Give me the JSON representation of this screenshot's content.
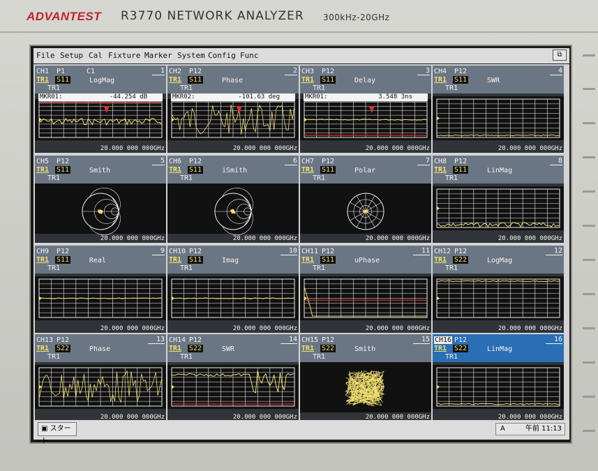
{
  "device": {
    "brand": "ADVANTEST",
    "model": "R3770  NETWORK  ANALYZER",
    "range": "300kHz-20GHz"
  },
  "menu": [
    "File",
    "Setup",
    "Cal",
    "Fixture",
    "Marker",
    "System",
    "Config",
    "Func"
  ],
  "channels": [
    {
      "ch": "CH1",
      "port": "P1",
      "extra": "C1",
      "num": "1",
      "tr": "TR1",
      "s": "S11",
      "fmt": "LogMag",
      "tr2": "TR1",
      "freq": "20.000 000 000GHz",
      "plot": "noise-red",
      "marker": {
        "label": "MKR01:",
        "value": "-44.254 dB"
      }
    },
    {
      "ch": "CH2",
      "port": "P12",
      "extra": "",
      "num": "2",
      "tr": "TR1",
      "s": "S11",
      "fmt": "Phase",
      "tr2": "TR1",
      "freq": "20.000 000 000GHz",
      "plot": "dense",
      "marker": {
        "label": "MKR02:",
        "value": "-101.63 deg"
      }
    },
    {
      "ch": "CH3",
      "port": "P12",
      "extra": "",
      "num": "3",
      "tr": "TR1",
      "s": "S11",
      "fmt": "Delay",
      "tr2": "TR1",
      "freq": "20.000 000 000GHz",
      "plot": "flat-red",
      "marker": {
        "label": "MKR01:",
        "value": "3.548 3ns"
      }
    },
    {
      "ch": "CH4",
      "port": "P12",
      "extra": "",
      "num": "4",
      "tr": "TR1",
      "s": "S11",
      "fmt": "SWR",
      "tr2": "TR1",
      "freq": "20.000 000 000GHz",
      "plot": "grid-bottom",
      "marker": null
    },
    {
      "ch": "CH5",
      "port": "P12",
      "extra": "",
      "num": "5",
      "tr": "TR1",
      "s": "S11",
      "fmt": "Smith",
      "tr2": "TR1",
      "freq": "20.000 000 000GHz",
      "plot": "smith",
      "marker": null
    },
    {
      "ch": "CH6",
      "port": "P12",
      "extra": "",
      "num": "6",
      "tr": "TR1",
      "s": "S11",
      "fmt": "iSmith",
      "tr2": "TR1",
      "freq": "20.000 000 000GHz",
      "plot": "smith",
      "marker": null
    },
    {
      "ch": "CH7",
      "port": "P12",
      "extra": "",
      "num": "7",
      "tr": "TR1",
      "s": "S11",
      "fmt": "Polar",
      "tr2": "TR1",
      "freq": "20.000 000 000GHz",
      "plot": "polar",
      "marker": null
    },
    {
      "ch": "CH8",
      "port": "P12",
      "extra": "",
      "num": "8",
      "tr": "TR1",
      "s": "S11",
      "fmt": "LinMag",
      "tr2": "TR1",
      "freq": "20.000 000 000GHz",
      "plot": "grid-bottom-noise",
      "marker": null
    },
    {
      "ch": "CH9",
      "port": "P12",
      "extra": "",
      "num": "9",
      "tr": "TR1",
      "s": "S11",
      "fmt": "Real",
      "tr2": "TR1",
      "freq": "20.000 000 000GHz",
      "plot": "grid-mid",
      "marker": null
    },
    {
      "ch": "CH10",
      "port": "P12",
      "extra": "",
      "num": "10",
      "tr": "TR1",
      "s": "S11",
      "fmt": "Imag",
      "tr2": "TR1",
      "freq": "20.000 000 000GHz",
      "plot": "grid-mid",
      "marker": null
    },
    {
      "ch": "CH11",
      "port": "P12",
      "extra": "",
      "num": "11",
      "tr": "TR1",
      "s": "S11",
      "fmt": "uPhase",
      "tr2": "TR1",
      "freq": "20.000 000 000GHz",
      "plot": "grid-step",
      "marker": null
    },
    {
      "ch": "CH12",
      "port": "P12",
      "extra": "",
      "num": "12",
      "tr": "TR1",
      "s": "S22",
      "fmt": "LogMag",
      "tr2": "TR1",
      "freq": "20.000 000 000GHz",
      "plot": "grid-top",
      "marker": null
    },
    {
      "ch": "CH13",
      "port": "P12",
      "extra": "",
      "num": "13",
      "tr": "TR1",
      "s": "S22",
      "fmt": "Phase",
      "tr2": "TR1",
      "freq": "20.000 000 000GHz",
      "plot": "dense",
      "marker": null
    },
    {
      "ch": "CH14",
      "port": "P12",
      "extra": "",
      "num": "14",
      "tr": "TR1",
      "s": "S22",
      "fmt": "SWR",
      "tr2": "TR1",
      "freq": "20.000 000 000GHz",
      "plot": "swr",
      "marker": null
    },
    {
      "ch": "CH15",
      "port": "P12",
      "extra": "",
      "num": "15",
      "tr": "TR1",
      "s": "S22",
      "fmt": "Smith",
      "tr2": "TR1",
      "freq": "20.000 000 000GHz",
      "plot": "blob",
      "marker": null
    },
    {
      "ch": "CH16",
      "port": "P12",
      "extra": "",
      "num": "16",
      "tr": "TR1",
      "s": "S22",
      "fmt": "LinMag",
      "tr2": "TR1",
      "freq": "20.000 000 000GHz",
      "plot": "grid-bottom",
      "marker": null,
      "active": true
    }
  ],
  "taskbar": {
    "start": "スタート",
    "clock": "午前 11:13",
    "ime": "A"
  },
  "colors": {
    "trace": "#f0e070",
    "marker": "#e03030",
    "grid": "#f0f0f0",
    "panel_header": "#6b7684",
    "active_header": "#2a6fb6"
  }
}
